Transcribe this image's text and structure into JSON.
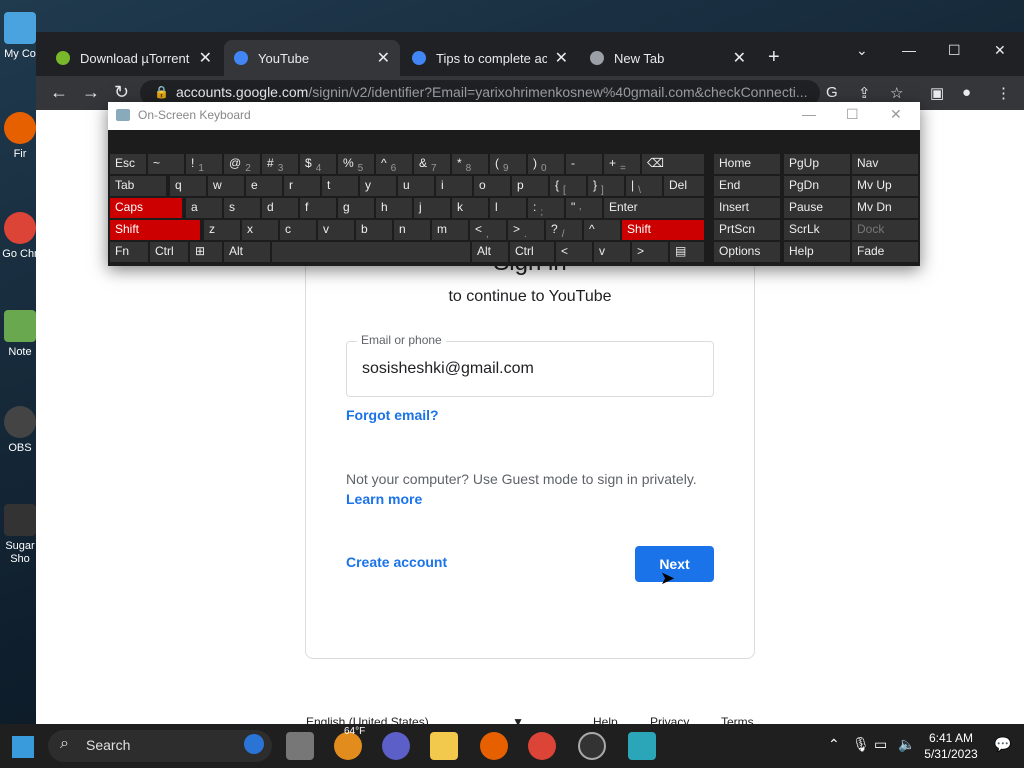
{
  "desktop": {
    "icons": [
      {
        "label": "My Co",
        "color": "#4aa3df"
      },
      {
        "label": "Fir",
        "color": "#e66000"
      },
      {
        "label": "Go Chr",
        "color": "#db4437"
      },
      {
        "label": "Note",
        "color": "#6aa84f"
      },
      {
        "label": "OBS",
        "color": "#444444"
      },
      {
        "label": "Sugar Sho",
        "color": "#333333"
      }
    ]
  },
  "browser": {
    "tabs": [
      {
        "title": "Download µTorrent (",
        "favicon_color": "#78b82a"
      },
      {
        "title": "YouTube",
        "favicon_color": "#4285f4"
      },
      {
        "title": "Tips to complete acc",
        "favicon_color": "#4285f4"
      },
      {
        "title": "New Tab",
        "favicon_color": "#9aa0a6"
      }
    ],
    "url_host": "accounts.google.com",
    "url_path": "/signin/v2/identifier?Email=yarixohrimenkosnew%40gmail.com&checkConnecti..."
  },
  "signin": {
    "title": "Sign in",
    "subtitle": "to continue to YouTube",
    "email_label": "Email or phone",
    "email_value": "sosisheshki@gmail.com",
    "forgot_email": "Forgot email?",
    "guest_text": "Not your computer? Use Guest mode to sign in privately.",
    "learn_more": "Learn more",
    "create_account": "Create account",
    "next": "Next"
  },
  "footer": {
    "language": "English (United States)",
    "help": "Help",
    "privacy": "Privacy",
    "terms": "Terms"
  },
  "keyboard": {
    "title": "On-Screen Keyboard",
    "rows": [
      [
        [
          "Esc",
          ""
        ],
        [
          "~",
          ""
        ],
        [
          "!",
          "1"
        ],
        [
          "@",
          "2"
        ],
        [
          "#",
          "3"
        ],
        [
          "$",
          "4"
        ],
        [
          "%",
          "5"
        ],
        [
          "^",
          "6"
        ],
        [
          "&",
          "7"
        ],
        [
          "*",
          "8"
        ],
        [
          "(",
          "9"
        ],
        [
          ")",
          "0"
        ],
        [
          "-",
          ""
        ],
        [
          "+",
          "="
        ],
        [
          "⌫",
          ""
        ]
      ],
      [
        [
          "Tab",
          ""
        ],
        [
          "q",
          ""
        ],
        [
          "w",
          ""
        ],
        [
          "e",
          ""
        ],
        [
          "r",
          ""
        ],
        [
          "t",
          ""
        ],
        [
          "y",
          ""
        ],
        [
          "u",
          ""
        ],
        [
          "i",
          ""
        ],
        [
          "o",
          ""
        ],
        [
          "p",
          ""
        ],
        [
          "{",
          "["
        ],
        [
          "}",
          "]"
        ],
        [
          "|",
          "\\"
        ],
        [
          "Del",
          ""
        ]
      ],
      [
        [
          "Caps",
          ""
        ],
        [
          "a",
          ""
        ],
        [
          "s",
          ""
        ],
        [
          "d",
          ""
        ],
        [
          "f",
          ""
        ],
        [
          "g",
          ""
        ],
        [
          "h",
          ""
        ],
        [
          "j",
          ""
        ],
        [
          "k",
          ""
        ],
        [
          "l",
          ""
        ],
        [
          ":",
          ";"
        ],
        [
          "\"",
          "'"
        ],
        [
          "Enter",
          ""
        ]
      ],
      [
        [
          "Shift",
          ""
        ],
        [
          "z",
          ""
        ],
        [
          "x",
          ""
        ],
        [
          "c",
          ""
        ],
        [
          "v",
          ""
        ],
        [
          "b",
          ""
        ],
        [
          "n",
          ""
        ],
        [
          "m",
          ""
        ],
        [
          "<",
          ","
        ],
        [
          ">",
          "."
        ],
        [
          "?",
          "/"
        ],
        [
          "^",
          ""
        ],
        [
          "Shift",
          ""
        ]
      ],
      [
        [
          "Fn",
          ""
        ],
        [
          "Ctrl",
          ""
        ],
        [
          "⊞",
          ""
        ],
        [
          "Alt",
          ""
        ],
        [
          "",
          ""
        ],
        [
          "Alt",
          ""
        ],
        [
          "Ctrl",
          ""
        ],
        [
          "<",
          ""
        ],
        [
          "v",
          ""
        ],
        [
          ">",
          ""
        ],
        [
          "▤",
          ""
        ]
      ]
    ],
    "nav_keys": [
      [
        "Home",
        "PgUp",
        "Nav"
      ],
      [
        "End",
        "PgDn",
        "Mv Up"
      ],
      [
        "Insert",
        "Pause",
        "Mv Dn"
      ],
      [
        "PrtScn",
        "ScrLk",
        "Dock"
      ],
      [
        "Options",
        "Help",
        "Fade"
      ]
    ]
  },
  "taskbar": {
    "search": "Search",
    "weather": "64°F",
    "time": "6:41 AM",
    "date": "5/31/2023"
  }
}
